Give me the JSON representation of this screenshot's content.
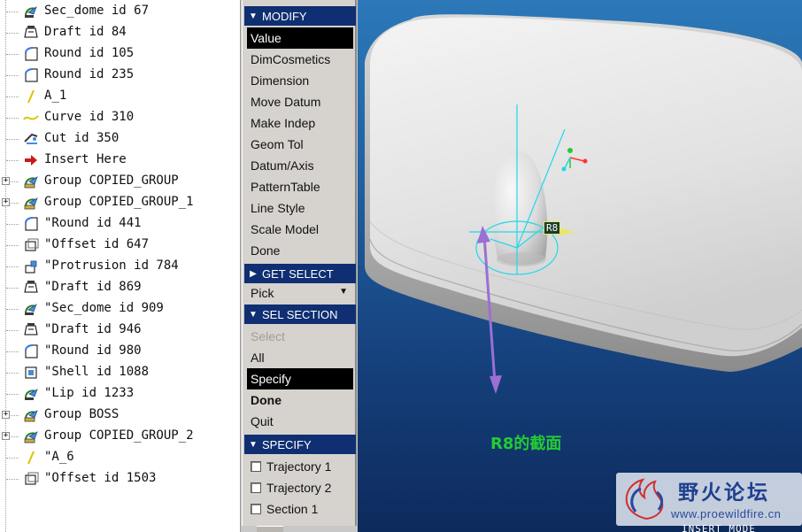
{
  "model_tree": {
    "items": [
      {
        "label": "Sec_dome id 67",
        "icon": "sec-dome-icon",
        "expandable": false,
        "marker": ""
      },
      {
        "label": "Draft id 84",
        "icon": "draft-icon",
        "expandable": false,
        "marker": ""
      },
      {
        "label": "Round id 105",
        "icon": "round-icon",
        "expandable": false,
        "marker": ""
      },
      {
        "label": "Round id 235",
        "icon": "round-icon",
        "expandable": false,
        "marker": ""
      },
      {
        "label": "A_1",
        "icon": "axis-icon",
        "expandable": false,
        "marker": ""
      },
      {
        "label": "Curve id 310",
        "icon": "curve-icon",
        "expandable": false,
        "marker": ""
      },
      {
        "label": "Cut id 350",
        "icon": "cut-icon",
        "expandable": false,
        "marker": ""
      },
      {
        "label": "Insert Here",
        "icon": "insert-arrow-icon",
        "expandable": false,
        "marker": ""
      },
      {
        "label": "Group COPIED_GROUP",
        "icon": "group-icon",
        "expandable": true,
        "marker": ""
      },
      {
        "label": "Group COPIED_GROUP_1",
        "icon": "group-icon",
        "expandable": true,
        "marker": ""
      },
      {
        "label": "Round id 441",
        "icon": "round-icon",
        "expandable": false,
        "marker": "\""
      },
      {
        "label": "Offset id 647",
        "icon": "offset-icon",
        "expandable": false,
        "marker": "\""
      },
      {
        "label": "Protrusion id 784",
        "icon": "protrusion-icon",
        "expandable": false,
        "marker": "\""
      },
      {
        "label": "Draft id 869",
        "icon": "draft-icon",
        "expandable": false,
        "marker": "\""
      },
      {
        "label": "Sec_dome id 909",
        "icon": "sec-dome-icon",
        "expandable": false,
        "marker": "\""
      },
      {
        "label": "Draft id 946",
        "icon": "draft-icon",
        "expandable": false,
        "marker": "\""
      },
      {
        "label": "Round id 980",
        "icon": "round-icon",
        "expandable": false,
        "marker": "\""
      },
      {
        "label": "Shell id 1088",
        "icon": "shell-icon",
        "expandable": false,
        "marker": "\""
      },
      {
        "label": "Lip id 1233",
        "icon": "lip-icon",
        "expandable": false,
        "marker": "\""
      },
      {
        "label": "Group BOSS",
        "icon": "group-icon",
        "expandable": true,
        "marker": ""
      },
      {
        "label": "Group COPIED_GROUP_2",
        "icon": "group-icon",
        "expandable": true,
        "marker": ""
      },
      {
        "label": "A_6",
        "icon": "axis-icon",
        "expandable": false,
        "marker": "\""
      },
      {
        "label": "Offset id 1503",
        "icon": "offset-icon",
        "expandable": false,
        "marker": "\""
      }
    ]
  },
  "menu": {
    "modify": {
      "header": "MODIFY",
      "items": [
        "Value",
        "DimCosmetics",
        "Dimension",
        "Move Datum",
        "Make Indep",
        "Geom Tol",
        "Datum/Axis",
        "PatternTable",
        "Line Style",
        "Scale Model",
        "Done"
      ],
      "selected": "Value"
    },
    "get_select": {
      "header": "GET SELECT",
      "value": "Pick"
    },
    "sel_section": {
      "header": "SEL SECTION",
      "items": [
        "Select",
        "All",
        "Specify",
        "Done",
        "Quit"
      ],
      "selected": "Specify",
      "disabled": "Select",
      "bold": "Done"
    },
    "specify": {
      "header": "SPECIFY",
      "items": [
        "Trajectory 1",
        "Trajectory 2",
        "Section 1"
      ]
    }
  },
  "viewport": {
    "dimension_label": "R8",
    "caption": "R8的截面",
    "mode": "INSERT MODE",
    "caption_color": "#22cc33",
    "arrow_color": "#9b6fd4",
    "datum_color": "#22d8e8"
  },
  "watermark": {
    "title": "野火论坛",
    "url": "www.proewildfire.cn"
  }
}
